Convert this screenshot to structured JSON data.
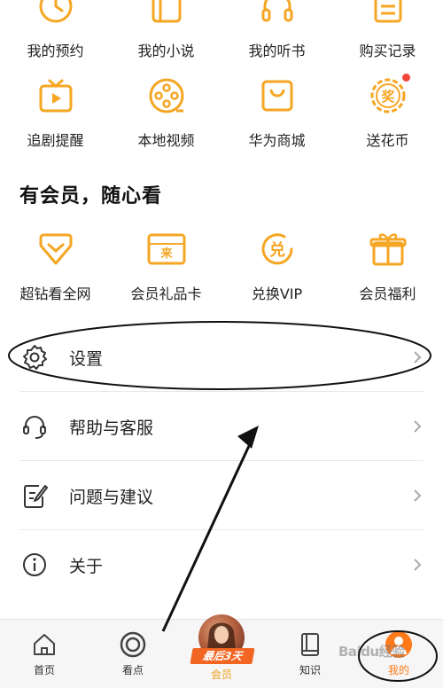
{
  "accent_color": "#f5a623",
  "grid_rows": [
    {
      "items": [
        {
          "label": "我的预约",
          "icon": "clock-icon"
        },
        {
          "label": "我的小说",
          "icon": "book-icon"
        },
        {
          "label": "我的听书",
          "icon": "headphones-icon"
        },
        {
          "label": "购买记录",
          "icon": "receipt-icon"
        }
      ]
    },
    {
      "items": [
        {
          "label": "追剧提醒",
          "icon": "tv-play-icon"
        },
        {
          "label": "本地视频",
          "icon": "film-reel-icon"
        },
        {
          "label": "华为商城",
          "icon": "shopping-bag-icon"
        },
        {
          "label": "送花币",
          "icon": "prize-coin-icon"
        }
      ]
    }
  ],
  "vip_section": {
    "title": "有会员，随心看",
    "items": [
      {
        "label": "超钻看全网",
        "icon": "diamond-icon"
      },
      {
        "label": "会员礼品卡",
        "icon": "gift-card-icon"
      },
      {
        "label": "兑换VIP",
        "icon": "exchange-icon",
        "glyph": "兑"
      },
      {
        "label": "会员福利",
        "icon": "gift-box-icon"
      }
    ]
  },
  "menu": [
    {
      "label": "设置",
      "icon": "gear-icon"
    },
    {
      "label": "帮助与客服",
      "icon": "headset-icon"
    },
    {
      "label": "问题与建议",
      "icon": "feedback-icon"
    },
    {
      "label": "关于",
      "icon": "info-icon"
    }
  ],
  "card_glyph": "来",
  "prize_glyph": "奖",
  "tabbar": {
    "tabs": [
      {
        "label": "首页",
        "icon": "home-icon"
      },
      {
        "label": "看点",
        "icon": "target-icon"
      },
      {
        "label": "会员",
        "icon": "promo-avatar"
      },
      {
        "label": "知识",
        "icon": "book-tab-icon"
      },
      {
        "label": "我的",
        "icon": "profile-icon"
      }
    ],
    "promo_tag": "最后3天"
  },
  "watermark": "Baidu经验"
}
